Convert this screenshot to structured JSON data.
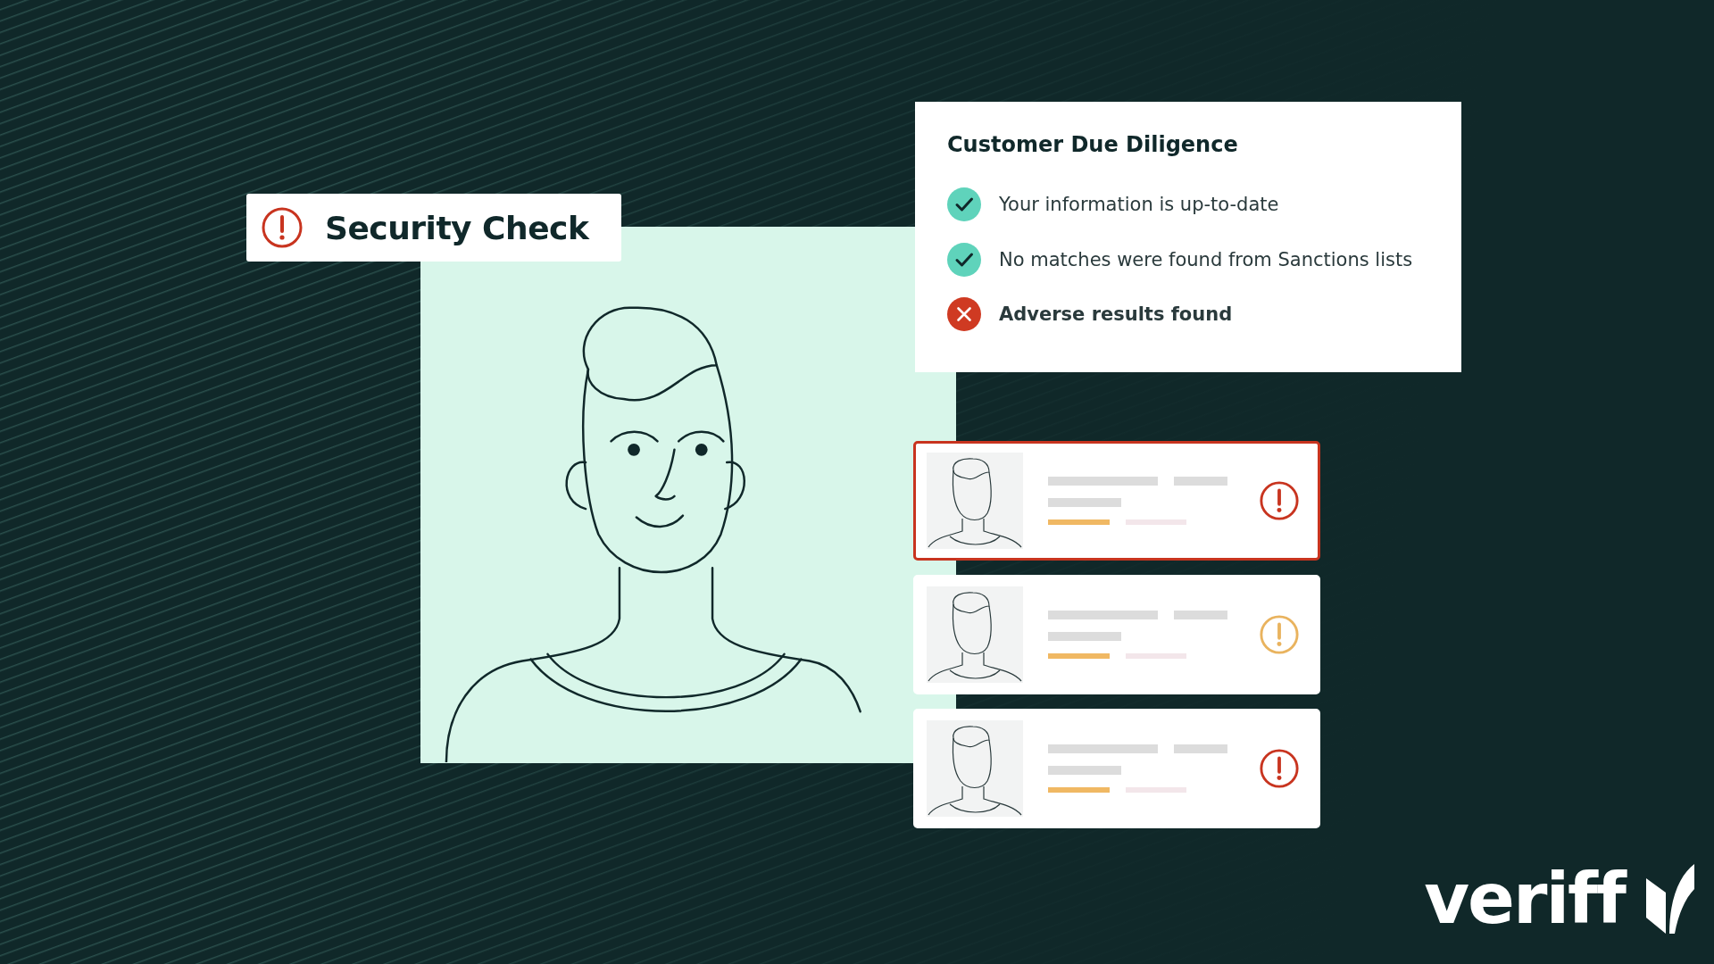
{
  "badge": {
    "title": "Security Check"
  },
  "due_diligence": {
    "title": "Customer Due Diligence",
    "checks": [
      {
        "text": "Your information is up-to-date",
        "passed": true
      },
      {
        "text": "No matches were found from Sanctions lists",
        "passed": true
      },
      {
        "text": "Adverse results found",
        "passed": false
      }
    ]
  },
  "results": [
    {
      "selected": true,
      "color": "#c8341f"
    },
    {
      "selected": false,
      "color": "#e9b35e"
    },
    {
      "selected": false,
      "color": "#c8341f"
    }
  ],
  "logo": {
    "text": "veriff"
  }
}
